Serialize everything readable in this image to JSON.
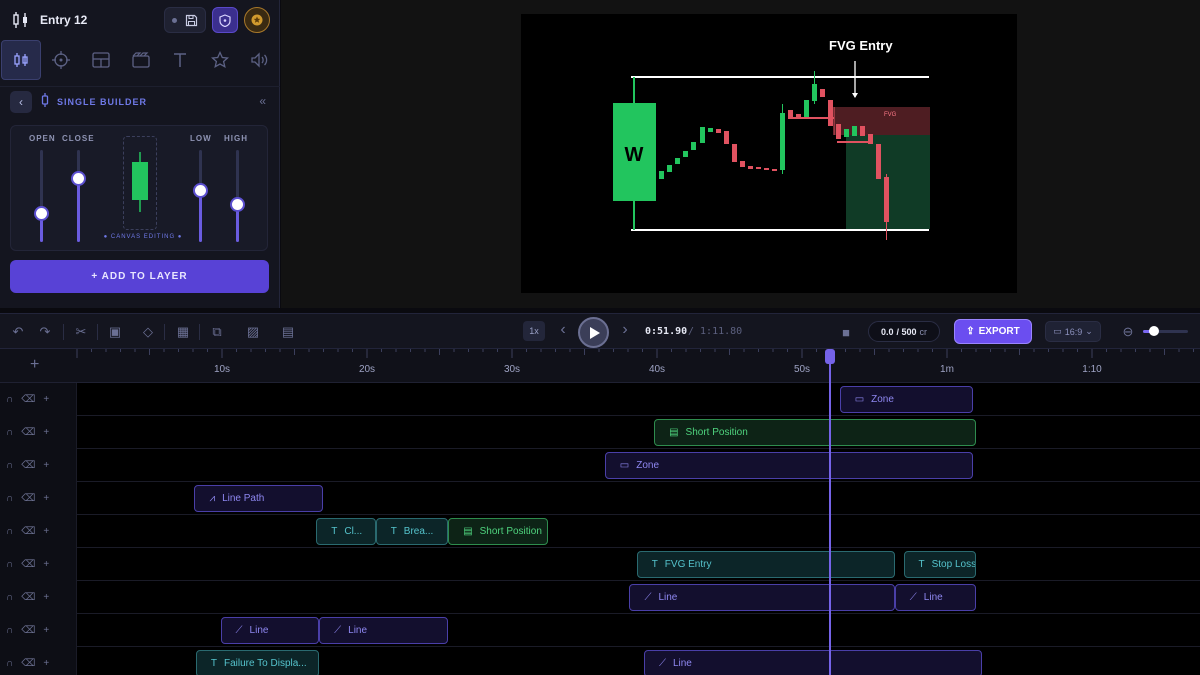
{
  "header": {
    "entry_title": "Entry 12"
  },
  "tool_tabs": [
    {
      "icon": "candlestick-icon"
    },
    {
      "icon": "crosshair-icon"
    },
    {
      "icon": "layout-icon"
    },
    {
      "icon": "clapper-icon"
    },
    {
      "icon": "text-icon"
    },
    {
      "icon": "star-icon"
    },
    {
      "icon": "speaker-icon"
    }
  ],
  "builder": {
    "mode_label": "SINGLE BUILDER",
    "sliders": [
      {
        "label": "OPEN",
        "value": 0.31
      },
      {
        "label": "CLOSE",
        "value": 0.7
      },
      {
        "label": "LOW",
        "value": 0.57
      },
      {
        "label": "HIGH",
        "value": 0.41
      }
    ],
    "canvas_editing_label": "● CANVAS EDITING ●",
    "add_layer_label": "+ ADD TO LAYER"
  },
  "preview": {
    "annotation_label": "FVG Entry",
    "zone_label": "FVG",
    "big_candle_label": "W"
  },
  "toolbar": {
    "speed": "1x",
    "time_current": "0:51.90",
    "time_total": "/ 1:11.80",
    "credits_used": "0.0",
    "credits_total": "/ 500",
    "credits_unit": "cr",
    "export_label": "EXPORT",
    "aspect_ratio": "16:9",
    "zoom_level": 0.25
  },
  "timeline": {
    "ruler_labels": [
      "10s",
      "20s",
      "30s",
      "40s",
      "50s",
      "1m",
      "1:10"
    ],
    "playhead_time": "0:51.90",
    "tracks": [
      {
        "clips": [
          {
            "label": "Zone",
            "type": "purple",
            "icon": "zone-icon",
            "start": 52.6,
            "end": 61.8
          }
        ]
      },
      {
        "clips": [
          {
            "label": "Short Position",
            "type": "green",
            "icon": "position-icon",
            "start": 39.8,
            "end": 62.0
          }
        ]
      },
      {
        "clips": [
          {
            "label": "Zone",
            "type": "purple",
            "icon": "zone-icon",
            "start": 36.4,
            "end": 61.8
          }
        ]
      },
      {
        "clips": [
          {
            "label": "Line Path",
            "type": "purple",
            "icon": "path-icon",
            "start": 8.1,
            "end": 17.0
          }
        ]
      },
      {
        "clips": [
          {
            "label": "Cl...",
            "type": "teal",
            "icon": "text-icon",
            "start": 16.5,
            "end": 20.6
          },
          {
            "label": "Brea...",
            "type": "teal",
            "icon": "text-icon",
            "start": 20.6,
            "end": 25.6
          },
          {
            "label": "Short Position",
            "type": "green",
            "icon": "position-icon",
            "start": 25.6,
            "end": 32.5
          }
        ]
      },
      {
        "clips": [
          {
            "label": "FVG Entry",
            "type": "teal",
            "icon": "text-icon",
            "start": 38.6,
            "end": 56.4
          },
          {
            "label": "Stop Loss",
            "type": "teal",
            "icon": "text-icon",
            "start": 57.0,
            "end": 62.0
          }
        ]
      },
      {
        "clips": [
          {
            "label": "Line",
            "type": "purple",
            "icon": "line-icon",
            "start": 38.1,
            "end": 56.4
          },
          {
            "label": "Line",
            "type": "purple",
            "icon": "line-icon",
            "start": 56.4,
            "end": 62.0
          }
        ]
      },
      {
        "clips": [
          {
            "label": "Line",
            "type": "purple",
            "icon": "line-icon",
            "start": 9.9,
            "end": 16.7
          },
          {
            "label": "Line",
            "type": "purple",
            "icon": "line-icon",
            "start": 16.7,
            "end": 25.6
          }
        ]
      },
      {
        "clips": [
          {
            "label": "Failure To Displa...",
            "type": "teal",
            "icon": "text-icon",
            "start": 8.2,
            "end": 16.7
          },
          {
            "label": "Line",
            "type": "purple",
            "icon": "line-icon",
            "start": 39.1,
            "end": 62.4
          }
        ]
      }
    ]
  },
  "colors": {
    "accent": "#6b4ef0",
    "bull": "#22c55e",
    "bear": "#e05260",
    "playhead": "#7563e8"
  }
}
